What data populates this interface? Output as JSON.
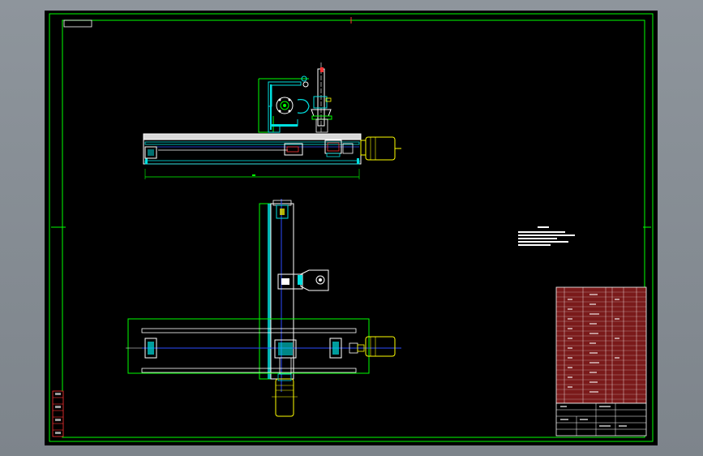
{
  "app": {
    "title": "",
    "background_color": "#8a9199",
    "viewport_color": "#000000"
  },
  "colors": {
    "border": "#00ff00",
    "part": "#ffffff",
    "section": "#00e0e0",
    "motor": "#ffff00",
    "table_fill": "#7a1a1a",
    "marker": "#ff3333",
    "axis": "#2b4bff"
  },
  "drawing": {
    "title_block_caption": "",
    "notes_heading": "",
    "notes_lines": [],
    "dimension_text": ""
  }
}
